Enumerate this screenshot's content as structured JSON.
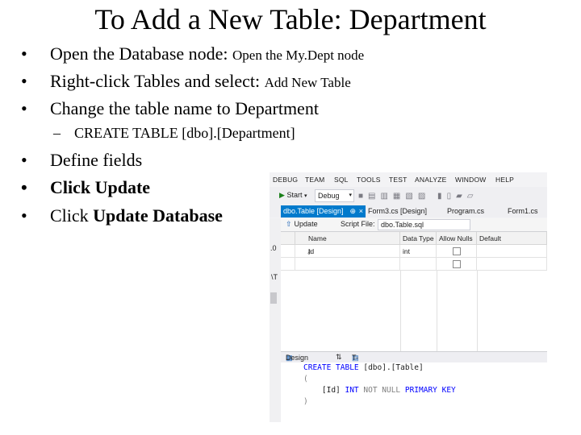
{
  "title": "To Add a New Table: Department",
  "bullets": [
    {
      "bullet": "•",
      "text": "Open the Database node: ",
      "small": "Open the My.Dept node"
    },
    {
      "bullet": "•",
      "text": "Right-click Tables and select: ",
      "small": "Add New Table"
    },
    {
      "bullet": "•",
      "text": "Change the table name to Department"
    }
  ],
  "sub_bullet": {
    "dash": "–",
    "text": "CREATE TABLE [dbo].[Department]"
  },
  "bullets2": [
    {
      "bullet": "•",
      "text": "Define fields"
    },
    {
      "bullet": "•",
      "text": "Click Update"
    },
    {
      "bullet": "•",
      "prefix": "Click ",
      "bold": "Update Database"
    }
  ],
  "vs": {
    "menu": [
      "DEBUG",
      "TEAM",
      "SQL",
      "TOOLS",
      "TEST",
      "ANALYZE",
      "WINDOW",
      "HELP"
    ],
    "start_label": "Start",
    "config": "Debug",
    "tabs": {
      "active": "dbo.Table [Design]",
      "pin": "⊕",
      "close": "×",
      "others": [
        "Form3.cs [Design]",
        "Program.cs",
        "Form1.cs"
      ]
    },
    "update_label": "Update",
    "script_file_label": "Script File:",
    "script_file": "dbo.Table.sql",
    "gutter": {
      "g1": ".0",
      "g2": "\\T"
    },
    "columns": [
      "Name",
      "Data Type",
      "Allow Nulls",
      "Default"
    ],
    "rows": [
      {
        "name": "Id",
        "type": "int",
        "key_icon": "⚷"
      },
      {
        "name": "",
        "type": ""
      }
    ],
    "design_tab": "Design",
    "swap": "⇅",
    "tsql_tab": "T-SQL",
    "code": {
      "l1_kw": "CREATE TABLE",
      "l1_rest": " [dbo].[Table]",
      "l2": "(",
      "l3_col": "    [Id] ",
      "l3_type": "INT",
      "l3_null": " NOT NULL ",
      "l3_pk": "PRIMARY KEY",
      "l4": ")"
    }
  }
}
